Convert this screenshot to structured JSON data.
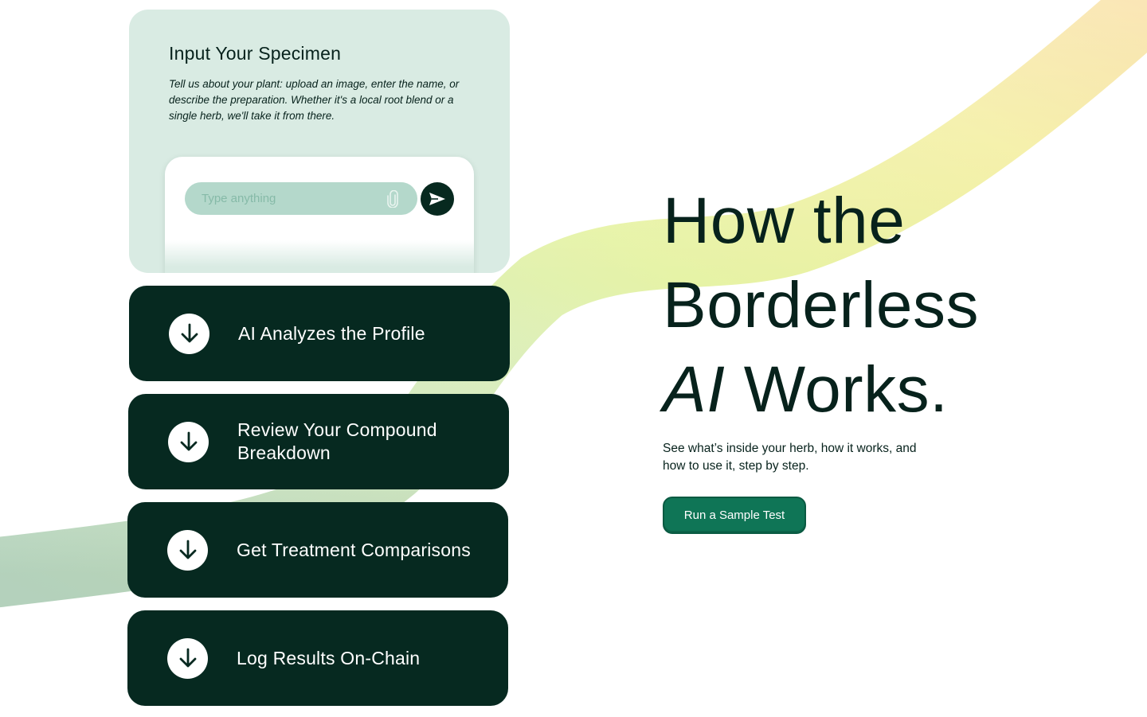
{
  "input_card": {
    "title": "Input Your Specimen",
    "description": "Tell us about your plant: upload an image, enter the name, or describe the preparation. Whether it's a local root blend or a single herb, we'll take it from there.",
    "chat": {
      "placeholder": "Type anything",
      "attach_icon": "paperclip-icon",
      "send_icon": "send-icon"
    }
  },
  "steps": [
    {
      "label": "AI Analyzes the Profile",
      "icon": "arrow-down-icon"
    },
    {
      "label": "Review Your Compound Breakdown",
      "icon": "arrow-down-icon"
    },
    {
      "label": "Get Treatment Comparisons",
      "icon": "arrow-down-icon"
    },
    {
      "label": "Log Results On-Chain",
      "icon": "arrow-down-icon"
    }
  ],
  "hero": {
    "title_line1": "How the",
    "title_line2": "Borderless",
    "title_em": "AI",
    "title_line3_rest": " Works.",
    "subtitle": "See what’s inside your herb, how it works, and how to use it, step by step.",
    "cta_label": "Run a Sample Test"
  },
  "colors": {
    "card_light": "#d9ebe3",
    "card_dark": "#062920",
    "accent": "#0f7556",
    "input_fill": "#b4d8cb"
  }
}
